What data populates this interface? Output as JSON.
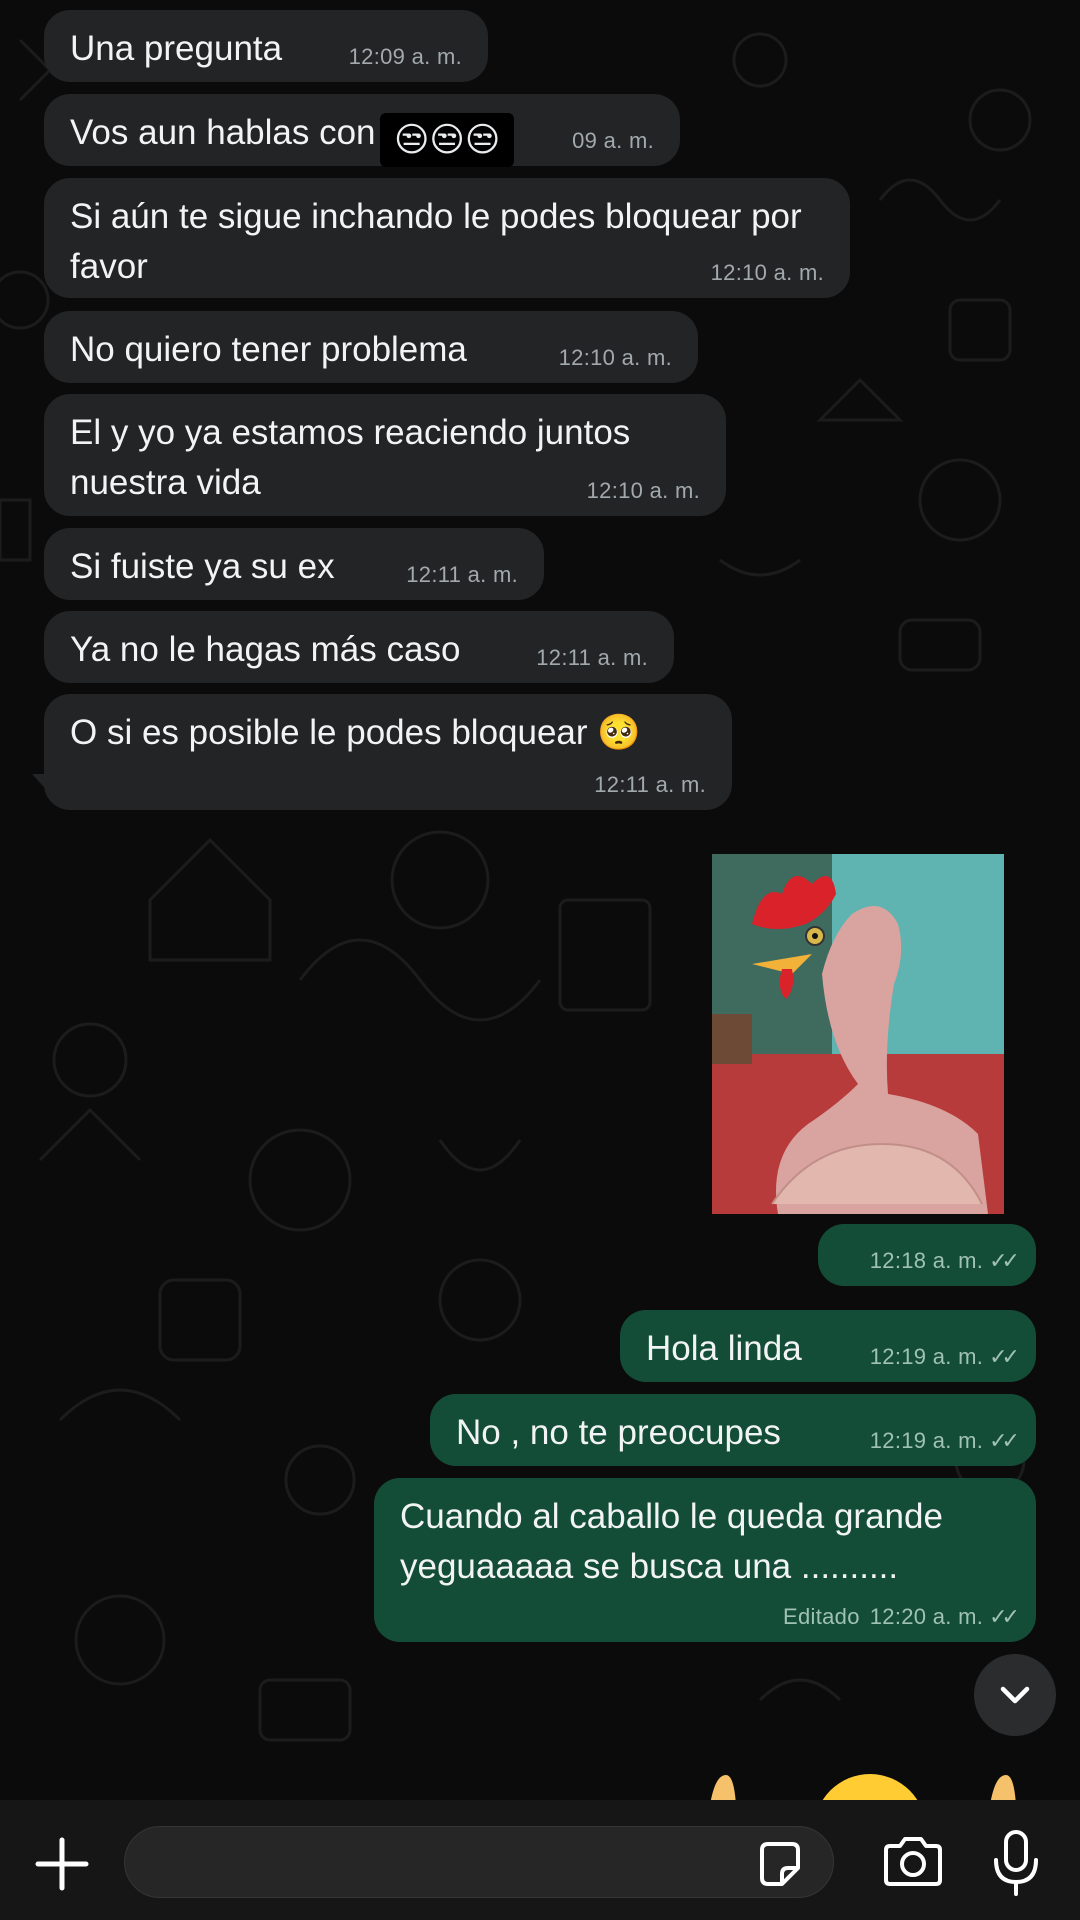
{
  "messages": [
    {
      "dir": "in",
      "text": "Una pregunta",
      "time": "12:09 a. m."
    },
    {
      "dir": "in",
      "text_before": "Vos aun hablas con",
      "emoji": "😒😒😒",
      "time": "09 a. m."
    },
    {
      "dir": "in",
      "text": "Si aún te sigue inchando le podes bloquear por favor",
      "time": "12:10 a. m."
    },
    {
      "dir": "in",
      "text": "No quiero tener problema",
      "time": "12:10 a. m."
    },
    {
      "dir": "in",
      "text": "El y yo ya estamos reaciendo juntos nuestra vida",
      "time": "12:10 a. m."
    },
    {
      "dir": "in",
      "text": "Si fuiste ya su ex",
      "time": "12:11 a. m."
    },
    {
      "dir": "in",
      "text": "Ya no le hagas más caso",
      "time": "12:11 a. m."
    },
    {
      "dir": "in",
      "text": "O si es posible le podes bloquear 🥺",
      "time": "12:11 a. m."
    },
    {
      "dir": "out",
      "type": "image",
      "image_desc": "plucked chicken with long neck",
      "time": "12:18 a. m.",
      "ticks": "✓✓"
    },
    {
      "dir": "out",
      "text": "Hola linda",
      "time": "12:19 a. m.",
      "ticks": "✓✓"
    },
    {
      "dir": "out",
      "text": "No , no te preocupes",
      "time": "12:19 a. m.",
      "ticks": "✓✓"
    },
    {
      "dir": "out",
      "text": "Cuando al caballo le queda grande yeguaaaaa se busca una ..........",
      "edited": "Editado",
      "time": "12:20 a. m.",
      "ticks": "✓✓"
    }
  ],
  "composer": {
    "input_value": "",
    "input_placeholder": ""
  },
  "icons": {
    "plus": "plus-icon",
    "sticker": "sticker-icon",
    "camera": "camera-icon",
    "mic": "microphone-icon",
    "scroll_down": "chevron-down-icon"
  },
  "colors": {
    "background": "#0b0b0b",
    "incoming_bubble": "#232425",
    "outgoing_bubble": "#144d37",
    "composer": "#161616"
  }
}
